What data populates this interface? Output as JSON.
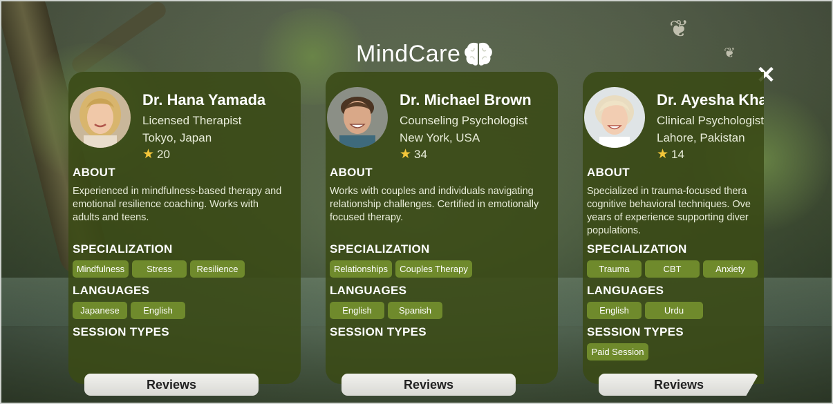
{
  "brand": {
    "name": "MindCare",
    "icon": "brain-icon"
  },
  "close": {
    "icon": "close-icon",
    "glyph": "✕"
  },
  "colors": {
    "card": "#3a4a16",
    "tag": "#6f8a2c",
    "star": "#f3c63a"
  },
  "therapists": [
    {
      "name": "Dr. Hana Yamada",
      "title": "Licensed Therapist",
      "location": "Tokyo, Japan",
      "rating_count": "20",
      "about_heading": "ABOUT",
      "about": "Experienced in mindfulness-based therapy and emotional resilience coaching. Works with adults and teens.",
      "specialization_heading": "SPECIALIZATION",
      "specializations": [
        "Mindfulness",
        "Stress",
        "Resilience"
      ],
      "languages_heading": "LANGUAGES",
      "languages": [
        "Japanese",
        "English"
      ],
      "session_types_heading": "SESSION TYPES",
      "session_types": [],
      "reviews_label": "Reviews"
    },
    {
      "name": "Dr. Michael Brown",
      "title": "Counseling Psychologist",
      "location": "New York, USA",
      "rating_count": "34",
      "about_heading": "ABOUT",
      "about": "Works with couples and individuals navigating relationship challenges. Certified in emotionally focused therapy.",
      "specialization_heading": "SPECIALIZATION",
      "specializations": [
        "Relationships",
        "Couples Therapy"
      ],
      "languages_heading": "LANGUAGES",
      "languages": [
        "English",
        "Spanish"
      ],
      "session_types_heading": "SESSION TYPES",
      "session_types": [],
      "reviews_label": "Reviews"
    },
    {
      "name": "Dr. Ayesha Kha",
      "title": "Clinical Psychologist",
      "location": "Lahore, Pakistan",
      "rating_count": "14",
      "about_heading": "ABOUT",
      "about": "Specialized in trauma-focused thera cognitive behavioral techniques. Ove years of experience supporting diver populations.",
      "specialization_heading": "SPECIALIZATION",
      "specializations": [
        "Trauma",
        "CBT",
        "Anxiety"
      ],
      "languages_heading": "LANGUAGES",
      "languages": [
        "English",
        "Urdu"
      ],
      "session_types_heading": "SESSION TYPES",
      "session_types": [
        "Paid Session"
      ],
      "reviews_label": "Reviews"
    }
  ]
}
